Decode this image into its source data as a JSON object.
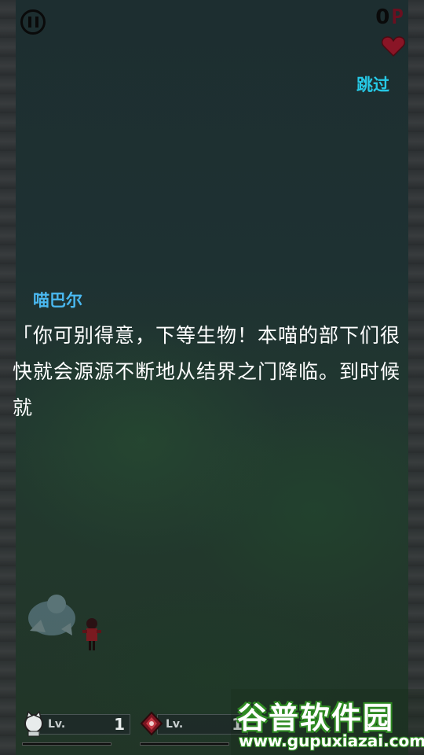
{
  "hud": {
    "score": "0",
    "score_unit": "P",
    "lives_icon": "heart-icon",
    "pause_icon": "pause-icon"
  },
  "skip": {
    "label": "跳过"
  },
  "dialogue": {
    "speaker": "喵巴尔",
    "text": "「你可别得意，下等生物！本喵的部下们很快就会源源不断地从结界之门降临。到时候就"
  },
  "levels": [
    {
      "icon": "cat-head-icon",
      "label": "Lv.",
      "value": "1"
    },
    {
      "icon": "red-diamond-icon",
      "label": "Lv.",
      "value": "1"
    }
  ],
  "watermark": {
    "title": "谷普软件园",
    "url": "www.gupuxiazai.com"
  },
  "colors": {
    "skip": "#26c9e6",
    "speaker": "#4ab8f0",
    "heart": "#8a1526",
    "watermark_green": "#2e8a22"
  }
}
